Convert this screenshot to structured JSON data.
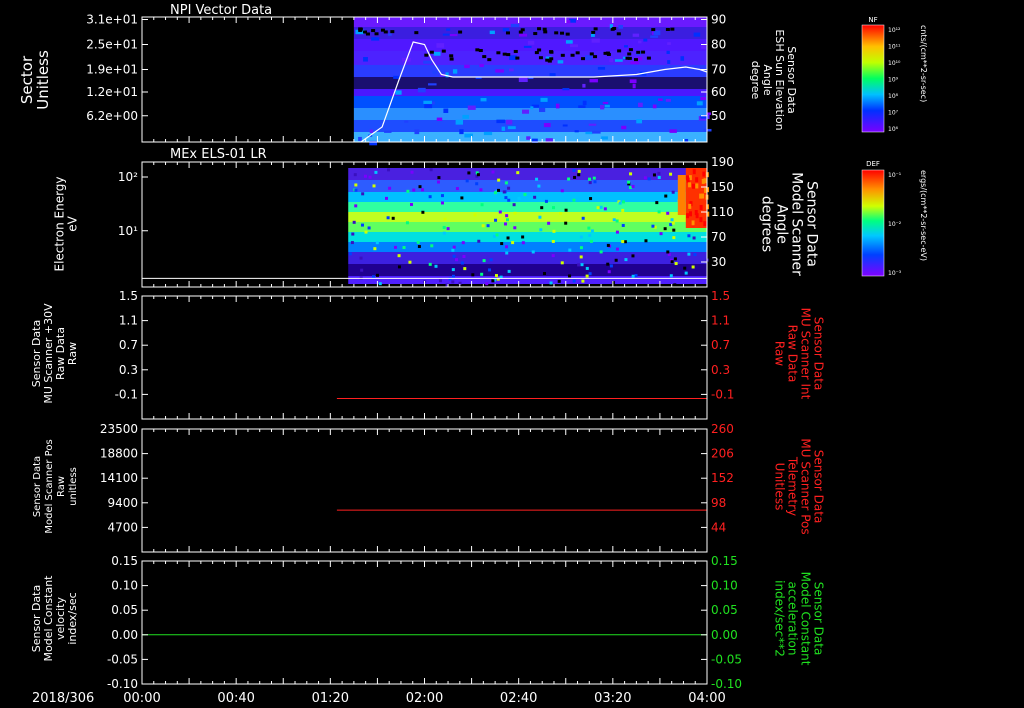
{
  "time_axis": {
    "date_label": "2018/306",
    "ticks": [
      "00:00",
      "00:40",
      "01:20",
      "02:00",
      "02:40",
      "03:20",
      "04:00"
    ],
    "range_hours": [
      0,
      4
    ]
  },
  "colors": {
    "white": "#ffffff",
    "red": "#ff2020",
    "green": "#20e020"
  },
  "chart_data": [
    {
      "id": "npi",
      "type": "heatmap",
      "title": "NPI Vector Data",
      "ylabel": [
        "Sector",
        "Unitless"
      ],
      "ytick_labels": [
        "3.1e+01",
        "2.5e+01",
        "1.9e+01",
        "1.2e+01",
        "6.2e+00"
      ],
      "ylabel_right": [
        "Sensor Data",
        "ESH Sun Elevation",
        "Angle",
        "degree"
      ],
      "ytick_labels_right": [
        "90",
        "80",
        "70",
        "60",
        "50"
      ],
      "ylim_right": [
        40,
        90
      ],
      "data_start_hour": 1.5,
      "colorbar": {
        "title": "NF",
        "unit": "cnts/(cm**2-sr-sec)",
        "tick_labels": [
          "10¹²",
          "10¹¹",
          "10¹⁰",
          "10⁹",
          "10⁸",
          "10⁷",
          "10⁶"
        ]
      },
      "overlay_line": {
        "color": "white",
        "points": [
          [
            1.55,
            40
          ],
          [
            1.7,
            46
          ],
          [
            1.82,
            65
          ],
          [
            1.92,
            80
          ],
          [
            2.0,
            79
          ],
          [
            2.05,
            73
          ],
          [
            2.12,
            67
          ],
          [
            2.2,
            66
          ],
          [
            3.2,
            66
          ],
          [
            3.5,
            67
          ],
          [
            3.7,
            69
          ],
          [
            3.85,
            70
          ],
          [
            3.95,
            69
          ],
          [
            4.0,
            68
          ]
        ]
      }
    },
    {
      "id": "els",
      "type": "heatmap",
      "title": "MEx ELS-01 LR",
      "ylabel": [
        "Electron Energy",
        "eV"
      ],
      "ytick_labels": [
        "10²",
        "10¹"
      ],
      "ylabel_right": [
        "Sensor Data",
        "Model Scanner",
        "Angle",
        "degrees"
      ],
      "ytick_labels_right": [
        "190",
        "150",
        "110",
        "70",
        "30"
      ],
      "ylim_right": [
        0,
        190
      ],
      "data_start_hour": 1.46,
      "colorbar": {
        "title": "DEF",
        "unit": "ergs/(cm**2-sr-sec-eV)",
        "tick_labels": [
          "10⁻¹",
          "10⁻²",
          "10⁻³"
        ]
      },
      "overlay_line": {
        "color": "white",
        "points": [
          [
            0,
            13
          ],
          [
            4,
            13
          ]
        ]
      }
    },
    {
      "id": "mu-int",
      "type": "line",
      "ylabel": [
        "Sensor Data",
        "MU Scanner +30V",
        "Raw Data",
        "Raw"
      ],
      "ytick_labels": [
        "1.5",
        "1.1",
        "0.7",
        "0.3",
        "-0.1"
      ],
      "ylim": [
        -0.3,
        1.5
      ],
      "ylabel_right": [
        "Sensor Data",
        "MU Scanner Int",
        "Raw Data",
        "Raw"
      ],
      "ylabel_right_color": "red",
      "ytick_labels_right": [
        "1.5",
        "1.1",
        "0.7",
        "0.3",
        "-0.1"
      ],
      "series": [
        {
          "color": "red",
          "x": [
            1.38,
            4.0
          ],
          "y": [
            0.0,
            0.0
          ]
        }
      ]
    },
    {
      "id": "mu-pos",
      "type": "line",
      "ylabel": [
        "Sensor Data",
        "Model Scanner Pos",
        "Raw",
        "unitless"
      ],
      "ytick_labels": [
        "23500",
        "18800",
        "14100",
        "9400",
        "4700"
      ],
      "ylim": [
        0,
        23500
      ],
      "ylabel_right": [
        "Sensor Data",
        "MU Scanner Pos",
        "Telemetry",
        "Unitless"
      ],
      "ylabel_right_color": "red",
      "ytick_labels_right": [
        "260",
        "206",
        "152",
        "98",
        "44"
      ],
      "series": [
        {
          "color": "red",
          "x": [
            1.38,
            4.0
          ],
          "y": [
            8000,
            8000
          ]
        }
      ]
    },
    {
      "id": "model-const",
      "type": "line",
      "ylabel": [
        "Sensor Data",
        "Model Constant",
        "velocity",
        "index/sec"
      ],
      "ytick_labels": [
        "0.15",
        "0.10",
        "0.05",
        "0.00",
        "-0.05",
        "-0.10"
      ],
      "ylim": [
        -0.1,
        0.15
      ],
      "ylabel_right": [
        "Sensor Data",
        "Model Constant",
        "acceleration",
        "index/sec**2"
      ],
      "ylabel_right_color": "green",
      "ytick_labels_right": [
        "0.15",
        "0.10",
        "0.05",
        "0.00",
        "-0.05",
        "-0.10"
      ],
      "series": [
        {
          "color": "green",
          "x": [
            0,
            4.0
          ],
          "y": [
            0.0,
            0.0
          ]
        }
      ]
    }
  ]
}
